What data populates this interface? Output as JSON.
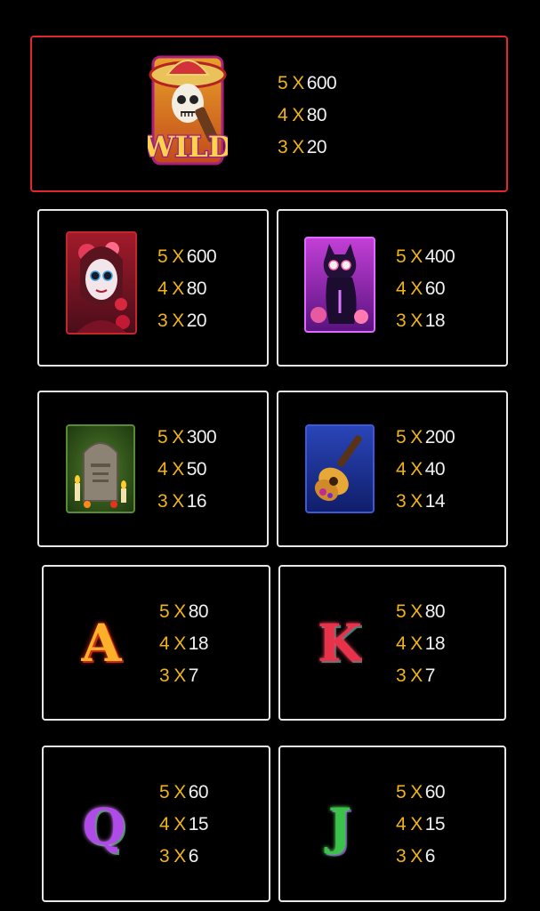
{
  "symbols": [
    {
      "id": "wild",
      "icon": "wild-skull-mariachi-icon",
      "label": "WILD",
      "pays": [
        {
          "count": "5",
          "value": "600"
        },
        {
          "count": "4",
          "value": "80"
        },
        {
          "count": "3",
          "value": "20"
        }
      ]
    },
    {
      "id": "catrina",
      "icon": "catrina-woman-icon",
      "pays": [
        {
          "count": "5",
          "value": "600"
        },
        {
          "count": "4",
          "value": "80"
        },
        {
          "count": "3",
          "value": "20"
        }
      ]
    },
    {
      "id": "cat",
      "icon": "sugar-skull-cat-icon",
      "pays": [
        {
          "count": "5",
          "value": "400"
        },
        {
          "count": "4",
          "value": "60"
        },
        {
          "count": "3",
          "value": "18"
        }
      ]
    },
    {
      "id": "tombstone",
      "icon": "tombstone-candles-icon",
      "pays": [
        {
          "count": "5",
          "value": "300"
        },
        {
          "count": "4",
          "value": "50"
        },
        {
          "count": "3",
          "value": "16"
        }
      ]
    },
    {
      "id": "guitar",
      "icon": "guitar-icon",
      "pays": [
        {
          "count": "5",
          "value": "200"
        },
        {
          "count": "4",
          "value": "40"
        },
        {
          "count": "3",
          "value": "14"
        }
      ]
    },
    {
      "id": "a",
      "icon": "letter-a-icon",
      "label": "A",
      "pays": [
        {
          "count": "5",
          "value": "80"
        },
        {
          "count": "4",
          "value": "18"
        },
        {
          "count": "3",
          "value": "7"
        }
      ]
    },
    {
      "id": "k",
      "icon": "letter-k-icon",
      "label": "K",
      "pays": [
        {
          "count": "5",
          "value": "80"
        },
        {
          "count": "4",
          "value": "18"
        },
        {
          "count": "3",
          "value": "7"
        }
      ]
    },
    {
      "id": "q",
      "icon": "letter-q-icon",
      "label": "Q",
      "pays": [
        {
          "count": "5",
          "value": "60"
        },
        {
          "count": "4",
          "value": "15"
        },
        {
          "count": "3",
          "value": "6"
        }
      ]
    },
    {
      "id": "j",
      "icon": "letter-j-icon",
      "label": "J",
      "pays": [
        {
          "count": "5",
          "value": "60"
        },
        {
          "count": "4",
          "value": "15"
        },
        {
          "count": "3",
          "value": "6"
        }
      ]
    }
  ],
  "multiplier_sign": "X",
  "colors": {
    "wild_border": "#e3262b",
    "card_border": "#e8e8e8",
    "count": "#f0b419",
    "value": "#f1f1f1",
    "background": "#000000"
  }
}
